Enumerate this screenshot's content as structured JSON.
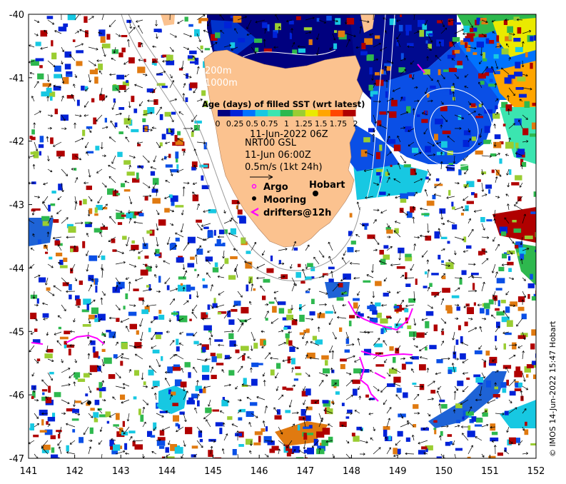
{
  "map": {
    "lon_range": [
      141,
      152
    ],
    "lat_range": [
      -47,
      -40
    ],
    "x_ticks": [
      "141",
      "142",
      "143",
      "144",
      "145",
      "146",
      "147",
      "148",
      "149",
      "150",
      "151",
      "152"
    ],
    "y_ticks": [
      "-40",
      "-41",
      "-42",
      "-43",
      "-44",
      "-45",
      "-46",
      "-47"
    ],
    "colors": {
      "land": "#fbc28f",
      "contour": "#9a9a9a",
      "white_contour": "#ffffff",
      "arrows": "#000000",
      "drifter": "#ff00ff",
      "argo": "#ff00ff"
    }
  },
  "depth_labels": [
    "200m",
    "1000m"
  ],
  "colorbar": {
    "title": "Age (days) of filled SST (wrt latest)",
    "ticks": [
      "0",
      "0.25",
      "0.5",
      "0.75",
      "1",
      "1.25",
      "1.5",
      "1.75",
      "2"
    ],
    "colors": [
      "#00007f",
      "#0022d8",
      "#0073ff",
      "#17c8e2",
      "#3be5b0",
      "#2eb84e",
      "#9acd32",
      "#eaea00",
      "#ffa500",
      "#ff4500",
      "#b00000"
    ]
  },
  "info": {
    "date": "11-Jun-2022 06Z",
    "product": "NRT00 GSL",
    "time": "11-Jun 06:00Z",
    "scale": "0.5m/s (1kt 24h)"
  },
  "legend": {
    "argo": "Argo",
    "mooring": "Mooring",
    "drifters": "drifters@12h"
  },
  "places": {
    "city": "Hobart"
  },
  "credit": "© IMOS 14-Jun-2022 15:47 Hobart"
}
